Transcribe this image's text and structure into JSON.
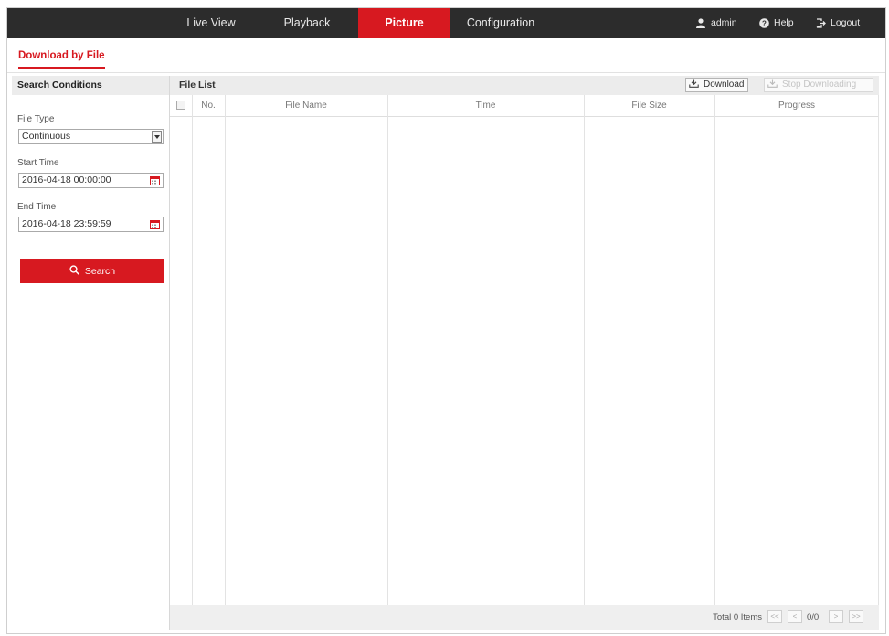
{
  "nav": {
    "tabs": [
      {
        "label": "Live View"
      },
      {
        "label": "Playback"
      },
      {
        "label": "Picture",
        "active": true
      },
      {
        "label": "Configuration"
      }
    ],
    "user": "admin",
    "help": "Help",
    "logout": "Logout"
  },
  "page_tab": "Download by File",
  "search_panel": {
    "title": "Search Conditions",
    "file_type_label": "File Type",
    "file_type_value": "Continuous",
    "start_time_label": "Start Time",
    "start_time_value": "2016-04-18 00:00:00",
    "end_time_label": "End Time",
    "end_time_value": "2016-04-18 23:59:59",
    "search_button": "Search"
  },
  "file_list": {
    "title": "File List",
    "download_button": "Download",
    "stop_download_button": "Stop Downloading",
    "columns": [
      "No.",
      "File Name",
      "Time",
      "File Size",
      "Progress"
    ],
    "rows": [],
    "total": "Total 0 Items",
    "pagination": {
      "first": "<<",
      "prev": "<",
      "page": "0/0",
      "next": ">",
      "last": ">>"
    }
  },
  "colors": {
    "accent": "#d71920",
    "nav_bg": "#2c2c2c"
  },
  "icons": [
    "user-icon",
    "help-icon",
    "logout-icon",
    "calendar-icon",
    "search-icon",
    "download-icon",
    "stop-download-icon"
  ]
}
